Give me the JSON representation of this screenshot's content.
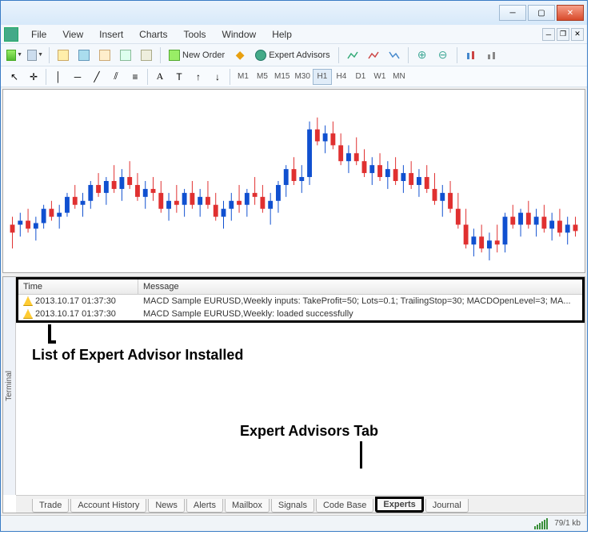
{
  "menus": [
    "File",
    "View",
    "Insert",
    "Charts",
    "Tools",
    "Window",
    "Help"
  ],
  "toolbar": {
    "new_order": "New Order",
    "expert_advisors": "Expert Advisors"
  },
  "timeframes": [
    "M1",
    "M5",
    "M15",
    "M30",
    "H1",
    "H4",
    "D1",
    "W1",
    "MN"
  ],
  "active_timeframe": "H1",
  "log": {
    "headers": {
      "time": "Time",
      "message": "Message"
    },
    "rows": [
      {
        "time": "2013.10.17 01:37:30",
        "message": "MACD Sample EURUSD,Weekly inputs: TakeProfit=50; Lots=0.1; TrailingStop=30; MACDOpenLevel=3; MA..."
      },
      {
        "time": "2013.10.17 01:37:30",
        "message": "MACD Sample EURUSD,Weekly: loaded successfully"
      }
    ]
  },
  "annotations": {
    "list_label": "List of Expert Advisor Installed",
    "tab_label": "Expert Advisors Tab"
  },
  "terminal_label": "Terminal",
  "tabs": [
    "Trade",
    "Account History",
    "News",
    "Alerts",
    "Mailbox",
    "Signals",
    "Code Base",
    "Experts",
    "Journal"
  ],
  "active_tab": "Experts",
  "status": {
    "transfer": "79/1 kb"
  },
  "chart_data": {
    "type": "candlestick",
    "note": "OHLC candlestick chart with no visible axis labels in screenshot; values are approximate pixel-derived.",
    "candles": [
      {
        "o": 180,
        "h": 160,
        "l": 200,
        "c": 170,
        "bull": false
      },
      {
        "o": 170,
        "h": 155,
        "l": 185,
        "c": 165,
        "bull": true
      },
      {
        "o": 165,
        "h": 150,
        "l": 180,
        "c": 175,
        "bull": false
      },
      {
        "o": 175,
        "h": 160,
        "l": 190,
        "c": 168,
        "bull": true
      },
      {
        "o": 168,
        "h": 145,
        "l": 175,
        "c": 150,
        "bull": true
      },
      {
        "o": 150,
        "h": 140,
        "l": 165,
        "c": 160,
        "bull": false
      },
      {
        "o": 160,
        "h": 145,
        "l": 175,
        "c": 155,
        "bull": true
      },
      {
        "o": 155,
        "h": 130,
        "l": 160,
        "c": 135,
        "bull": true
      },
      {
        "o": 135,
        "h": 120,
        "l": 150,
        "c": 145,
        "bull": false
      },
      {
        "o": 145,
        "h": 130,
        "l": 160,
        "c": 140,
        "bull": true
      },
      {
        "o": 140,
        "h": 115,
        "l": 150,
        "c": 120,
        "bull": true
      },
      {
        "o": 120,
        "h": 105,
        "l": 135,
        "c": 130,
        "bull": false
      },
      {
        "o": 130,
        "h": 110,
        "l": 145,
        "c": 115,
        "bull": true
      },
      {
        "o": 115,
        "h": 95,
        "l": 130,
        "c": 125,
        "bull": false
      },
      {
        "o": 125,
        "h": 100,
        "l": 140,
        "c": 110,
        "bull": true
      },
      {
        "o": 110,
        "h": 90,
        "l": 125,
        "c": 120,
        "bull": false
      },
      {
        "o": 120,
        "h": 105,
        "l": 140,
        "c": 135,
        "bull": false
      },
      {
        "o": 135,
        "h": 115,
        "l": 150,
        "c": 125,
        "bull": true
      },
      {
        "o": 125,
        "h": 110,
        "l": 140,
        "c": 130,
        "bull": false
      },
      {
        "o": 130,
        "h": 115,
        "l": 155,
        "c": 150,
        "bull": false
      },
      {
        "o": 150,
        "h": 130,
        "l": 165,
        "c": 140,
        "bull": true
      },
      {
        "o": 140,
        "h": 120,
        "l": 155,
        "c": 145,
        "bull": false
      },
      {
        "o": 145,
        "h": 125,
        "l": 160,
        "c": 130,
        "bull": true
      },
      {
        "o": 130,
        "h": 115,
        "l": 150,
        "c": 145,
        "bull": false
      },
      {
        "o": 145,
        "h": 125,
        "l": 160,
        "c": 135,
        "bull": true
      },
      {
        "o": 135,
        "h": 115,
        "l": 150,
        "c": 145,
        "bull": false
      },
      {
        "o": 145,
        "h": 130,
        "l": 165,
        "c": 160,
        "bull": false
      },
      {
        "o": 160,
        "h": 140,
        "l": 175,
        "c": 150,
        "bull": true
      },
      {
        "o": 150,
        "h": 130,
        "l": 165,
        "c": 140,
        "bull": true
      },
      {
        "o": 140,
        "h": 120,
        "l": 155,
        "c": 145,
        "bull": false
      },
      {
        "o": 145,
        "h": 125,
        "l": 160,
        "c": 130,
        "bull": true
      },
      {
        "o": 130,
        "h": 110,
        "l": 145,
        "c": 135,
        "bull": false
      },
      {
        "o": 135,
        "h": 120,
        "l": 155,
        "c": 150,
        "bull": false
      },
      {
        "o": 150,
        "h": 130,
        "l": 170,
        "c": 140,
        "bull": true
      },
      {
        "o": 140,
        "h": 115,
        "l": 155,
        "c": 120,
        "bull": true
      },
      {
        "o": 120,
        "h": 95,
        "l": 135,
        "c": 100,
        "bull": true
      },
      {
        "o": 100,
        "h": 85,
        "l": 120,
        "c": 115,
        "bull": false
      },
      {
        "o": 115,
        "h": 95,
        "l": 130,
        "c": 110,
        "bull": true
      },
      {
        "o": 110,
        "h": 40,
        "l": 120,
        "c": 50,
        "bull": true
      },
      {
        "o": 50,
        "h": 35,
        "l": 70,
        "c": 65,
        "bull": false
      },
      {
        "o": 65,
        "h": 45,
        "l": 80,
        "c": 55,
        "bull": true
      },
      {
        "o": 55,
        "h": 40,
        "l": 75,
        "c": 70,
        "bull": false
      },
      {
        "o": 70,
        "h": 55,
        "l": 95,
        "c": 90,
        "bull": false
      },
      {
        "o": 90,
        "h": 70,
        "l": 105,
        "c": 80,
        "bull": true
      },
      {
        "o": 80,
        "h": 60,
        "l": 95,
        "c": 90,
        "bull": false
      },
      {
        "o": 90,
        "h": 75,
        "l": 110,
        "c": 105,
        "bull": false
      },
      {
        "o": 105,
        "h": 85,
        "l": 120,
        "c": 95,
        "bull": true
      },
      {
        "o": 95,
        "h": 80,
        "l": 115,
        "c": 110,
        "bull": false
      },
      {
        "o": 110,
        "h": 90,
        "l": 125,
        "c": 100,
        "bull": true
      },
      {
        "o": 100,
        "h": 85,
        "l": 120,
        "c": 115,
        "bull": false
      },
      {
        "o": 115,
        "h": 95,
        "l": 130,
        "c": 105,
        "bull": true
      },
      {
        "o": 105,
        "h": 90,
        "l": 125,
        "c": 120,
        "bull": false
      },
      {
        "o": 120,
        "h": 100,
        "l": 135,
        "c": 110,
        "bull": true
      },
      {
        "o": 110,
        "h": 95,
        "l": 130,
        "c": 125,
        "bull": false
      },
      {
        "o": 125,
        "h": 105,
        "l": 145,
        "c": 140,
        "bull": false
      },
      {
        "o": 140,
        "h": 120,
        "l": 160,
        "c": 130,
        "bull": true
      },
      {
        "o": 130,
        "h": 115,
        "l": 155,
        "c": 150,
        "bull": false
      },
      {
        "o": 150,
        "h": 130,
        "l": 175,
        "c": 170,
        "bull": false
      },
      {
        "o": 170,
        "h": 150,
        "l": 200,
        "c": 195,
        "bull": false
      },
      {
        "o": 195,
        "h": 175,
        "l": 210,
        "c": 185,
        "bull": true
      },
      {
        "o": 185,
        "h": 170,
        "l": 205,
        "c": 200,
        "bull": false
      },
      {
        "o": 200,
        "h": 180,
        "l": 215,
        "c": 190,
        "bull": true
      },
      {
        "o": 190,
        "h": 170,
        "l": 205,
        "c": 195,
        "bull": false
      },
      {
        "o": 195,
        "h": 155,
        "l": 205,
        "c": 160,
        "bull": true
      },
      {
        "o": 160,
        "h": 145,
        "l": 175,
        "c": 170,
        "bull": false
      },
      {
        "o": 170,
        "h": 150,
        "l": 185,
        "c": 155,
        "bull": true
      },
      {
        "o": 155,
        "h": 140,
        "l": 175,
        "c": 170,
        "bull": false
      },
      {
        "o": 170,
        "h": 150,
        "l": 185,
        "c": 160,
        "bull": true
      },
      {
        "o": 160,
        "h": 145,
        "l": 180,
        "c": 175,
        "bull": false
      },
      {
        "o": 175,
        "h": 155,
        "l": 190,
        "c": 165,
        "bull": true
      },
      {
        "o": 165,
        "h": 150,
        "l": 185,
        "c": 180,
        "bull": false
      },
      {
        "o": 180,
        "h": 160,
        "l": 195,
        "c": 170,
        "bull": true
      },
      {
        "o": 170,
        "h": 160,
        "l": 185,
        "c": 178,
        "bull": false
      }
    ]
  }
}
